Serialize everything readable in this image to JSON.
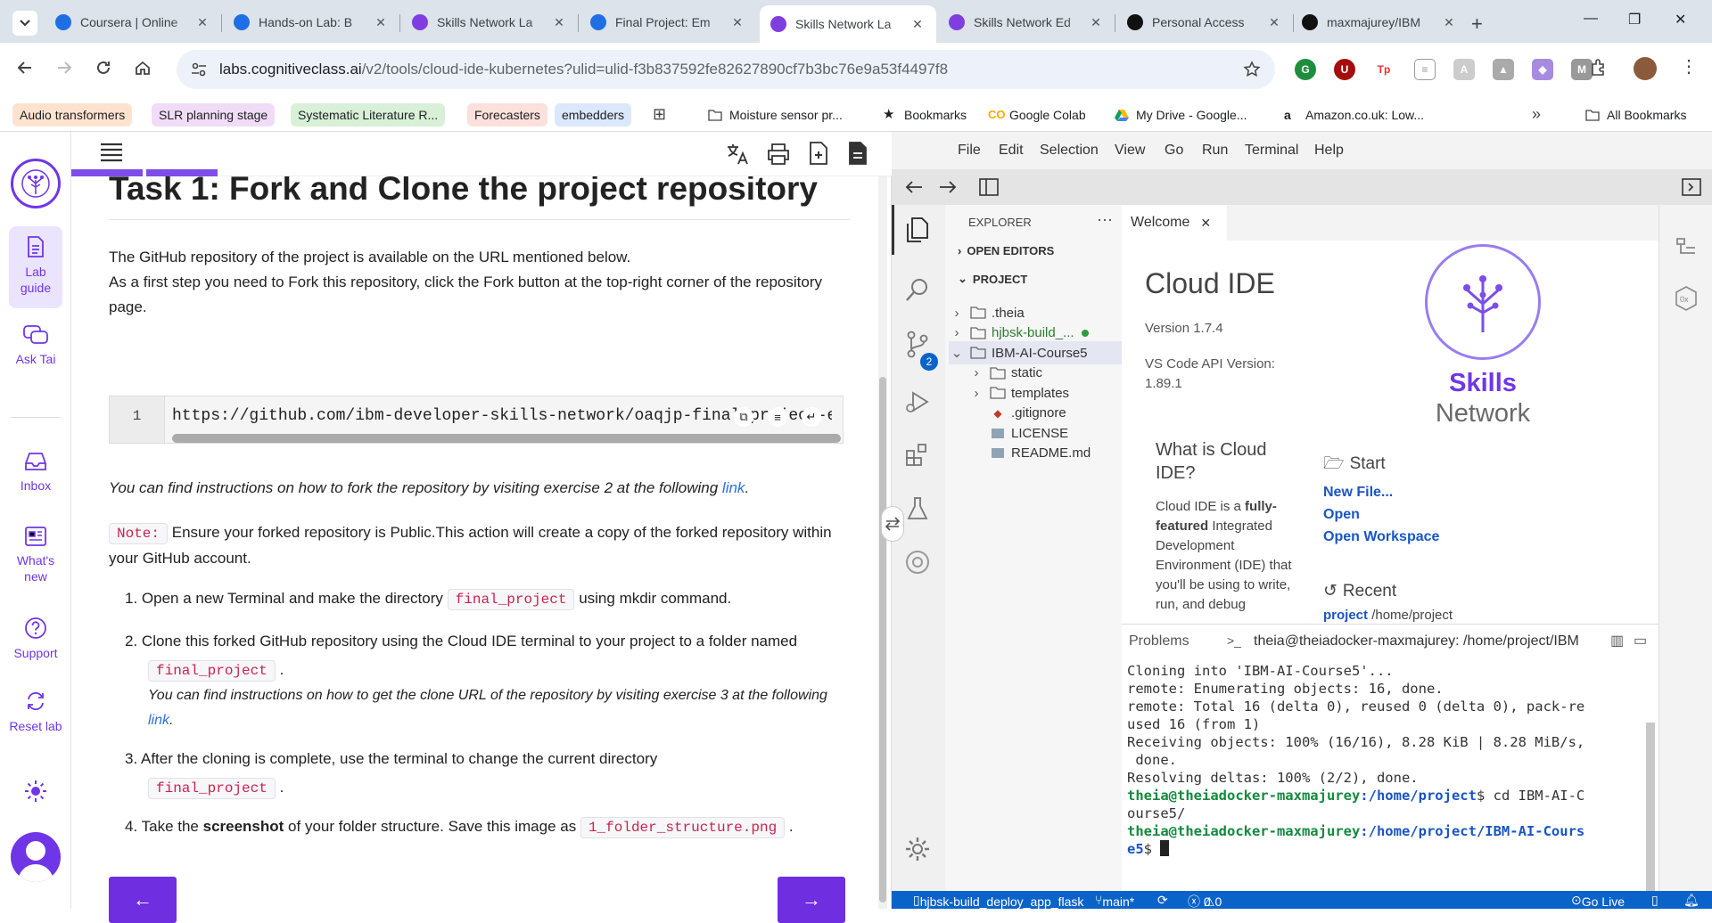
{
  "browser": {
    "tabs": [
      {
        "title": "Coursera | Online",
        "fav": "#1f6fe4"
      },
      {
        "title": "Hands-on Lab: B",
        "fav": "#1f6fe4"
      },
      {
        "title": "Skills Network La",
        "fav": "#7f3fe0"
      },
      {
        "title": "Final Project: Em",
        "fav": "#1f6fe4"
      },
      {
        "title": "Skills Network La",
        "fav": "#7f3fe0"
      },
      {
        "title": "Skills Network Ed",
        "fav": "#7f3fe0"
      },
      {
        "title": "Personal Access",
        "fav": "#111111"
      },
      {
        "title": "maxmajurey/IBM",
        "fav": "#111111"
      }
    ],
    "active_tab": 4,
    "url_host": "labs.cognitiveclass.ai",
    "url_path": "/v2/tools/cloud-ide-kubernetes?ulid=ulid-f3b837592fe82627890cf7b3bc76e9a53f4497f8",
    "bookmarks": [
      {
        "label": "Audio transformers",
        "bg": "#fde3cf"
      },
      {
        "label": "SLR planning stage",
        "bg": "#f1dcf7"
      },
      {
        "label": "Systematic Literature R...",
        "bg": "#d7f0d7"
      },
      {
        "label": "Forecasters",
        "bg": "#fbe0dc"
      },
      {
        "label": "embedders",
        "bg": "#dbe7fb"
      },
      {
        "label": "Moisture sensor pr...",
        "bg": ""
      },
      {
        "label": "Bookmarks",
        "bg": ""
      },
      {
        "label": "Google Colab",
        "bg": ""
      },
      {
        "label": "My Drive - Google...",
        "bg": ""
      },
      {
        "label": "Amazon.co.uk: Low...",
        "bg": ""
      }
    ],
    "all_bookmarks": "All Bookmarks"
  },
  "sidebar": {
    "items": [
      {
        "label": "Lab guide"
      },
      {
        "label": "Ask Tai"
      },
      {
        "label": "Inbox"
      },
      {
        "label": "What's new"
      },
      {
        "label": "Support"
      },
      {
        "label": "Reset lab"
      }
    ]
  },
  "guide": {
    "heading": "Task 1: Fork and Clone the project repository",
    "intro1": "The GitHub repository of the project is available on the URL mentioned below.",
    "intro2": "As a first step you need to Fork this repository, click the Fork button at the top-right corner of the repository page.",
    "code_line_no": "1",
    "code": "https://github.com/ibm-developer-skills-network/oaqjp-final-project-emb-ai.git",
    "fork_note_pre": "You can find instructions on how to fork the repository by visiting exercise 2 at the following ",
    "link": "link",
    "note_tag": "Note:",
    "note_text": "Ensure your forked repository is Public.This action will create a copy of the forked repository within your GitHub account.",
    "steps": [
      {
        "n": "1.",
        "pre": "Open a new Terminal and make the directory",
        "code": "final_project",
        "post": "using mkdir command."
      },
      {
        "n": "2.",
        "pre": "Clone this forked GitHub repository using the Cloud IDE terminal to your project to a folder named",
        "code": "final_project",
        "post": ".",
        "sub": "You can find instructions on how to get the clone URL of the repository by visiting exercise 3 at the following "
      },
      {
        "n": "3.",
        "pre": "After the cloning is complete, use the terminal to change the current directory",
        "code": "final_project",
        "post": "."
      },
      {
        "n": "4.",
        "pre": "Take the",
        "bold": "screenshot",
        "pre2": "of your folder structure. Save this image as",
        "code": "1_folder_structure.png",
        "post": "."
      }
    ],
    "prev_arrow": "←",
    "next_arrow": "→"
  },
  "ide": {
    "menus": [
      "File",
      "Edit",
      "Selection",
      "View",
      "Go",
      "Run",
      "Terminal",
      "Help"
    ],
    "explorer_title": "EXPLORER",
    "open_editors": "OPEN EDITORS",
    "project": "PROJECT",
    "tree": [
      {
        "label": ".theia",
        "type": "folder",
        "indent": 0,
        "open": false
      },
      {
        "label": "hjbsk-build_...",
        "type": "folder",
        "indent": 0,
        "open": false,
        "git": true
      },
      {
        "label": "IBM-AI-Course5",
        "type": "folder",
        "indent": 0,
        "open": true,
        "selected": true
      },
      {
        "label": "static",
        "type": "folder",
        "indent": 1,
        "open": false
      },
      {
        "label": "templates",
        "type": "folder",
        "indent": 1,
        "open": false
      },
      {
        "label": ".gitignore",
        "type": "git",
        "indent": 1
      },
      {
        "label": "LICENSE",
        "type": "file",
        "indent": 1
      },
      {
        "label": "README.md",
        "type": "file",
        "indent": 1
      }
    ],
    "scm_badge": "2",
    "editor_tab": "Welcome",
    "welcome": {
      "title": "Cloud IDE",
      "version": "Version 1.7.4",
      "api": "VS Code API Version: 1.89.1",
      "what_title": "What is Cloud IDE?",
      "what_pre": "Cloud IDE is a ",
      "what_bold": "fully-featured",
      "what_rest": " Integrated Development Environment (IDE) that you'll be using to write, run, and debug",
      "brand1": "Skills",
      "brand2": "Network",
      "start": "Start",
      "links": [
        "New File...",
        "Open",
        "Open Workspace"
      ],
      "recent": "Recent",
      "recent_item": "project",
      "recent_path": "/home/project"
    },
    "terminal": {
      "problems": "Problems",
      "title": "theia@theiadocker-maxmajurey: /home/project/IBM",
      "lines": [
        "Cloning into 'IBM-AI-Course5'...",
        "remote: Enumerating objects: 16, done.",
        "remote: Total 16 (delta 0), reused 0 (delta 0), pack-re",
        "used 16 (from 1)",
        "Receiving objects: 100% (16/16), 8.28 KiB | 8.28 MiB/s,",
        " done.",
        "Resolving deltas: 100% (2/2), done."
      ],
      "prompt_user": "theia@theiadocker-maxmajurey",
      "prompt1_path": ":/home/project",
      "prompt1_cmd": "$ cd IBM-AI-C",
      "prompt1_wrap": "ourse5/",
      "prompt2_path": ":/home/project/IBM-AI-Cours",
      "prompt2_wrap": "e5",
      "prompt2_tail": "$ "
    },
    "status": {
      "folder": "hjbsk-build_deploy_app_flask",
      "branch": "main*",
      "errors": "0",
      "warnings": "0",
      "golive": "Go Live"
    }
  }
}
